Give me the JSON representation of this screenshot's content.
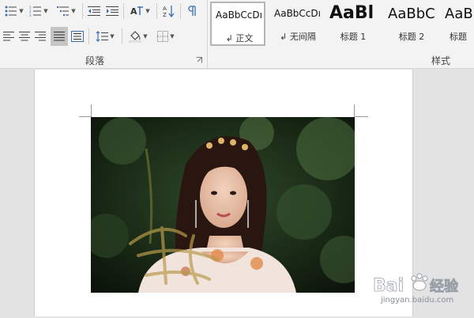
{
  "ribbon": {
    "paragraph_group_label": "段落",
    "styles_group_label": "样式",
    "styles": [
      {
        "sample": "AaBbCcDı",
        "name": "正文",
        "prefix": "↲",
        "selected": true
      },
      {
        "sample": "AaBbCcDı",
        "name": "无间隔",
        "prefix": "↲",
        "selected": false
      },
      {
        "sample": "AaBl",
        "name": "标题 1",
        "prefix": "",
        "selected": false
      },
      {
        "sample": "AaBbC",
        "name": "标题 2",
        "prefix": "",
        "selected": false
      },
      {
        "sample": "AaB",
        "name": "标题",
        "prefix": "",
        "selected": false
      }
    ]
  },
  "watermark": {
    "brand_text": "Bai",
    "brand_suffix": "经验",
    "url": "jingyan.baidu.com"
  },
  "colors": {
    "ribbon_bg": "#f3f3f3",
    "page_bg": "#ffffff",
    "canvas_bg": "#e3e3e3",
    "selected_tool": "#c5c5c5"
  }
}
